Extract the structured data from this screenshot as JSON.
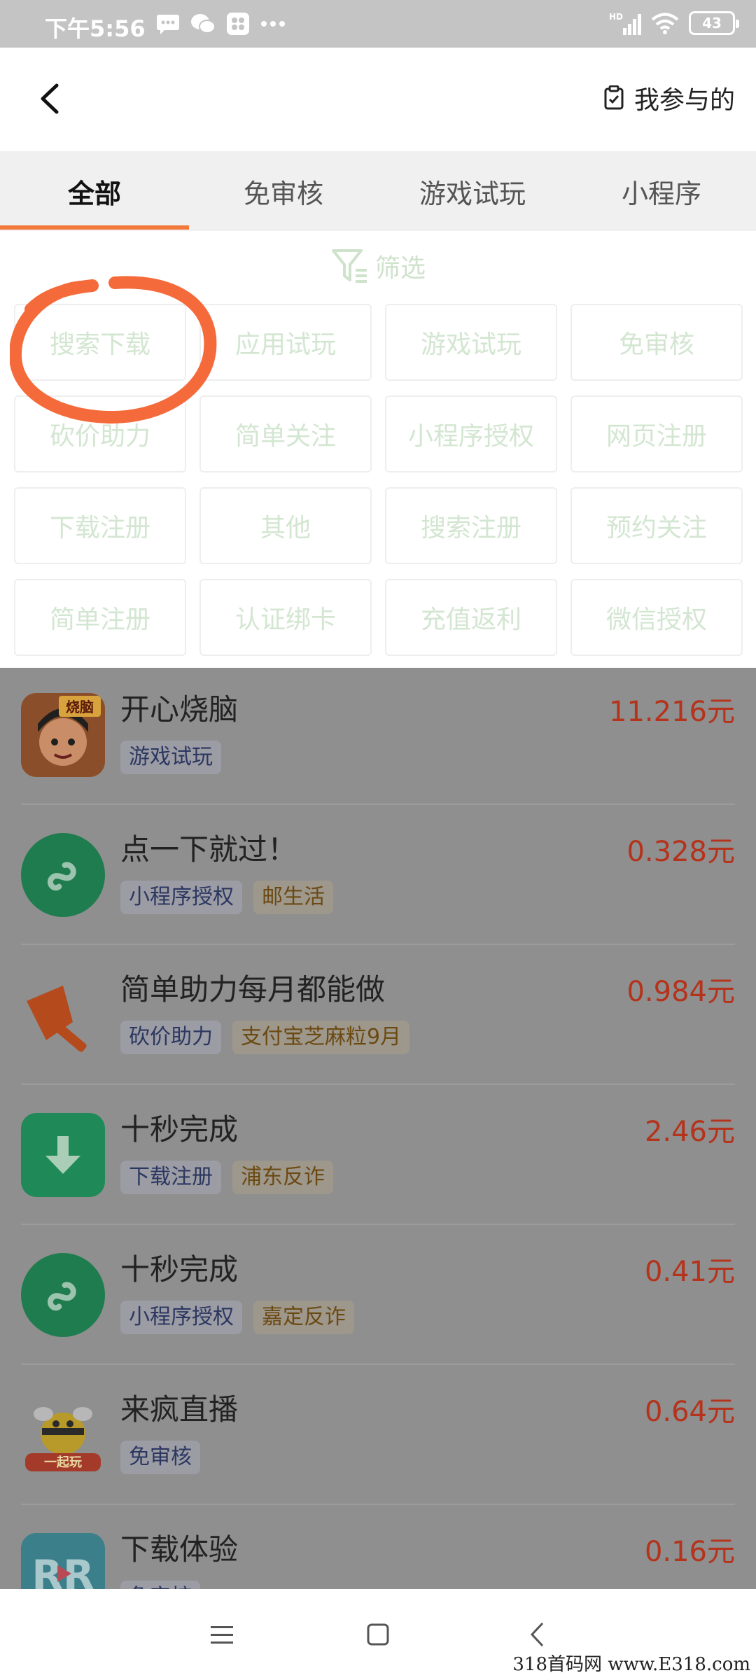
{
  "status_bar": {
    "time": "下午5:56",
    "battery": "43",
    "network": "HD"
  },
  "header": {
    "my_joined_label": "我参与的"
  },
  "tabs": [
    {
      "label": "全部",
      "active": true
    },
    {
      "label": "免审核",
      "active": false
    },
    {
      "label": "游戏试玩",
      "active": false
    },
    {
      "label": "小程序",
      "active": false
    }
  ],
  "filter": {
    "title": "筛选",
    "options": [
      "搜索下载",
      "应用试玩",
      "游戏试玩",
      "免审核",
      "砍价助力",
      "简单关注",
      "小程序授权",
      "网页注册",
      "下载注册",
      "其他",
      "搜索注册",
      "预约关注",
      "简单注册",
      "认证绑卡",
      "充值返利",
      "微信授权"
    ]
  },
  "tasks": [
    {
      "title": "开心烧脑",
      "price": "11.216元",
      "tags": [
        "游戏试玩"
      ],
      "warm_tags": [],
      "icon": "game-icon",
      "icon_text": "烧脑"
    },
    {
      "title": "点一下就过！",
      "price": "0.328元",
      "tags": [
        "小程序授权"
      ],
      "warm_tags": [
        "邮生活"
      ],
      "icon": "mini-program-icon"
    },
    {
      "title": "简单助力每月都能做",
      "price": "0.984元",
      "tags": [
        "砍价助力"
      ],
      "warm_tags": [
        "支付宝芝麻粒9月"
      ],
      "icon": "axe-icon"
    },
    {
      "title": "十秒完成",
      "price": "2.46元",
      "tags": [
        "下载注册"
      ],
      "warm_tags": [
        "浦东反诈"
      ],
      "icon": "download-icon"
    },
    {
      "title": "十秒完成",
      "price": "0.41元",
      "tags": [
        "小程序授权"
      ],
      "warm_tags": [
        "嘉定反诈"
      ],
      "icon": "mini-program-icon"
    },
    {
      "title": "来疯直播",
      "price": "0.64元",
      "tags": [
        "免审核"
      ],
      "warm_tags": [],
      "icon": "bee-icon",
      "icon_text": "一起玩"
    },
    {
      "title": "下载体验",
      "price": "0.16元",
      "tags": [
        "免审核"
      ],
      "warm_tags": [],
      "icon": "rr-logo-icon",
      "icon_text": "RR"
    }
  ],
  "watermark": "318首码网  www.E318.com",
  "colors": {
    "accent_orange": "#f2793b",
    "price_red": "#b5321b",
    "filter_text": "#d3e6d1"
  }
}
